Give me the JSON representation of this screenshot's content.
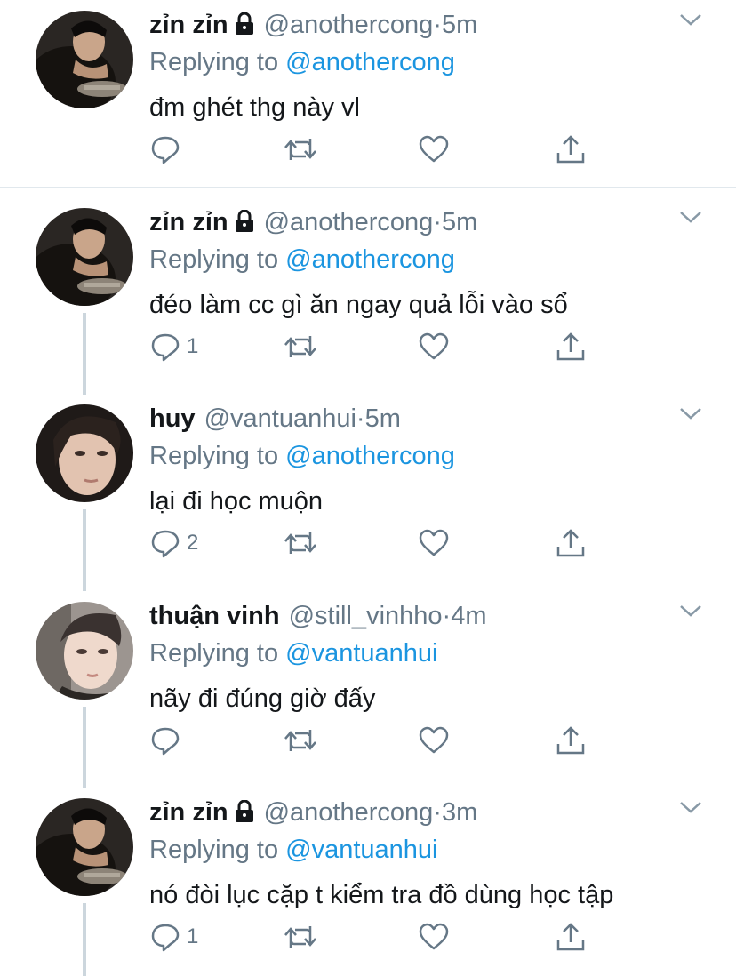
{
  "tweets": [
    {
      "name": "zỉn zỉn",
      "protected": true,
      "handle": "@anothercong",
      "dot": "·",
      "time": "5m",
      "reply_prefix": "Replying to ",
      "reply_to": "@anothercong",
      "text": "đm ghét thg này vl",
      "reply_count": "",
      "avatar": "dark"
    },
    {
      "name": "zỉn zỉn",
      "protected": true,
      "handle": "@anothercong",
      "dot": "·",
      "time": "5m",
      "reply_prefix": "Replying to ",
      "reply_to": "@anothercong",
      "text": "đéo làm cc gì ăn ngay quả lỗi vào sổ",
      "reply_count": "1",
      "avatar": "dark"
    },
    {
      "name": "huy",
      "protected": false,
      "handle": "@vantuanhui",
      "dot": "·",
      "time": "5m",
      "reply_prefix": "Replying to ",
      "reply_to": "@anothercong",
      "text": "lại đi học muộn",
      "reply_count": "2",
      "avatar": "face"
    },
    {
      "name": "thuận vinh",
      "protected": false,
      "handle": "@still_vinhho",
      "dot": "·",
      "time": "4m",
      "reply_prefix": "Replying to ",
      "reply_to": "@vantuanhui",
      "text": "nãy đi đúng giờ đấy",
      "reply_count": "",
      "avatar": "face2"
    },
    {
      "name": "zỉn zỉn",
      "protected": true,
      "handle": "@anothercong",
      "dot": "·",
      "time": "3m",
      "reply_prefix": "Replying to ",
      "reply_to": "@vantuanhui",
      "text": "nó đòi lục cặp t kiểm tra đồ dùng học tập",
      "reply_count": "1",
      "avatar": "dark"
    }
  ],
  "icons": {
    "reply": "reply-icon",
    "retweet": "retweet-icon",
    "like": "like-icon",
    "share": "share-icon",
    "lock": "lock-icon",
    "more": "chevron-down-icon"
  },
  "colors": {
    "link": "#1b95e0",
    "muted": "#657786",
    "text": "#14171a",
    "line": "#ccd6dd"
  }
}
